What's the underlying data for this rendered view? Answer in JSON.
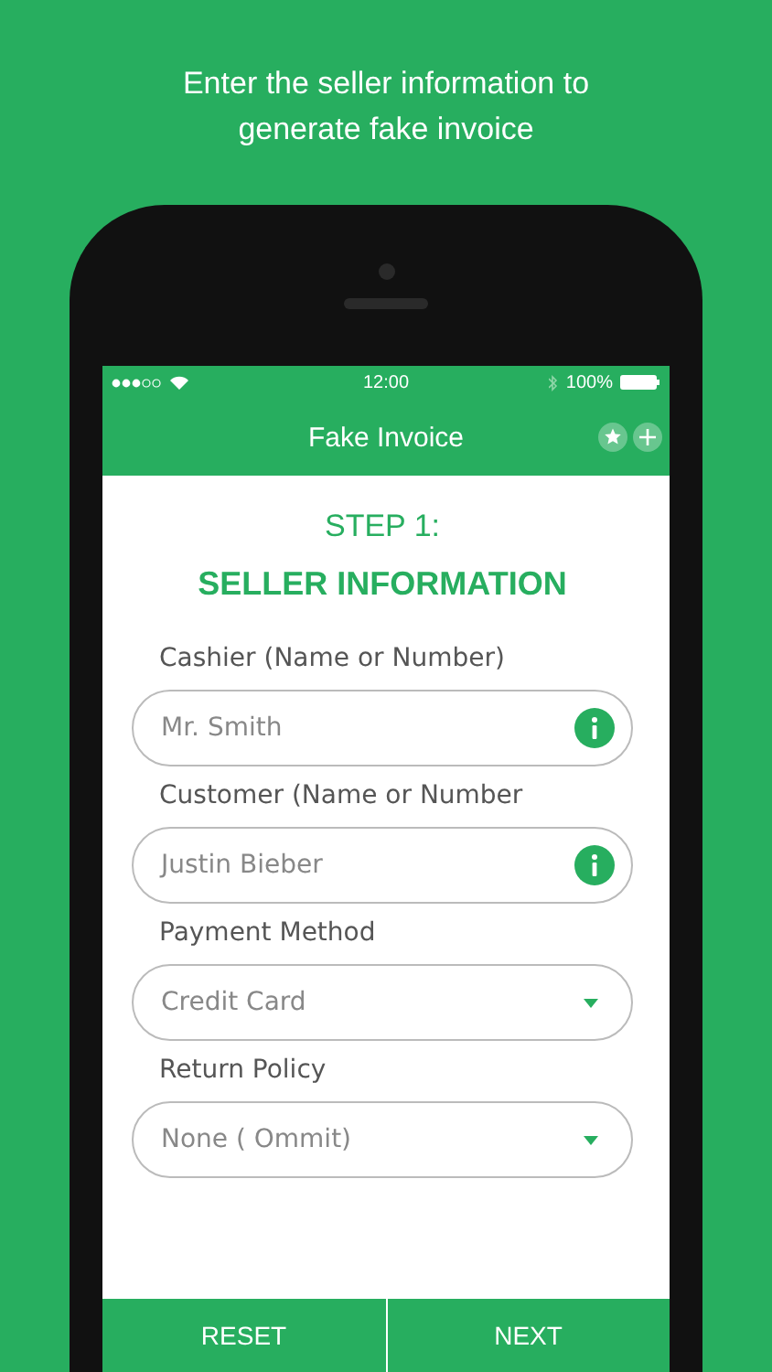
{
  "caption": "Enter the seller information to generate fake invoice",
  "status_bar": {
    "time": "12:00",
    "battery": "100%"
  },
  "nav": {
    "title": "Fake Invoice"
  },
  "step": "STEP 1:",
  "heading": "SELLER INFORMATION",
  "fields": [
    {
      "kind": "text",
      "label": "Cashier (Name or Number)",
      "value": "Mr. Smith"
    },
    {
      "kind": "text",
      "label": "Customer (Name or Number",
      "value": "Justin Bieber"
    },
    {
      "kind": "select",
      "label": "Payment Method",
      "value": "Credit Card"
    },
    {
      "kind": "select",
      "label": "Return Policy",
      "value": "None ( Ommit)"
    }
  ],
  "buttons": [
    "RESET",
    "NEXT"
  ]
}
